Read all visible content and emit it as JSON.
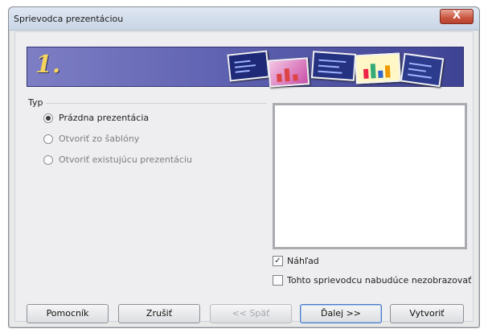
{
  "window": {
    "title": "Sprievodca prezentáciou",
    "close_label": "X"
  },
  "banner": {
    "step": "1."
  },
  "type_group": {
    "label": "Typ",
    "options": [
      {
        "label": "Prázdna prezentácia",
        "selected": true
      },
      {
        "label": "Otvoriť zo šablóny",
        "selected": false
      },
      {
        "label": "Otvoriť existujúcu prezentáciu",
        "selected": false
      }
    ]
  },
  "checkboxes": {
    "preview": {
      "label": "Náhľad",
      "checked": true
    },
    "dont_show": {
      "label": "Tohto sprievodcu nabudúce nezobrazovať",
      "checked": false
    }
  },
  "buttons": {
    "help": "Pomocník",
    "cancel": "Zrušiť",
    "back": "<< Späť",
    "next": "Ďalej >>",
    "create": "Vytvoriť"
  },
  "colors": {
    "banner": "#5f62b1",
    "step_number": "#f4d45f",
    "close_button": "#c8553f"
  }
}
